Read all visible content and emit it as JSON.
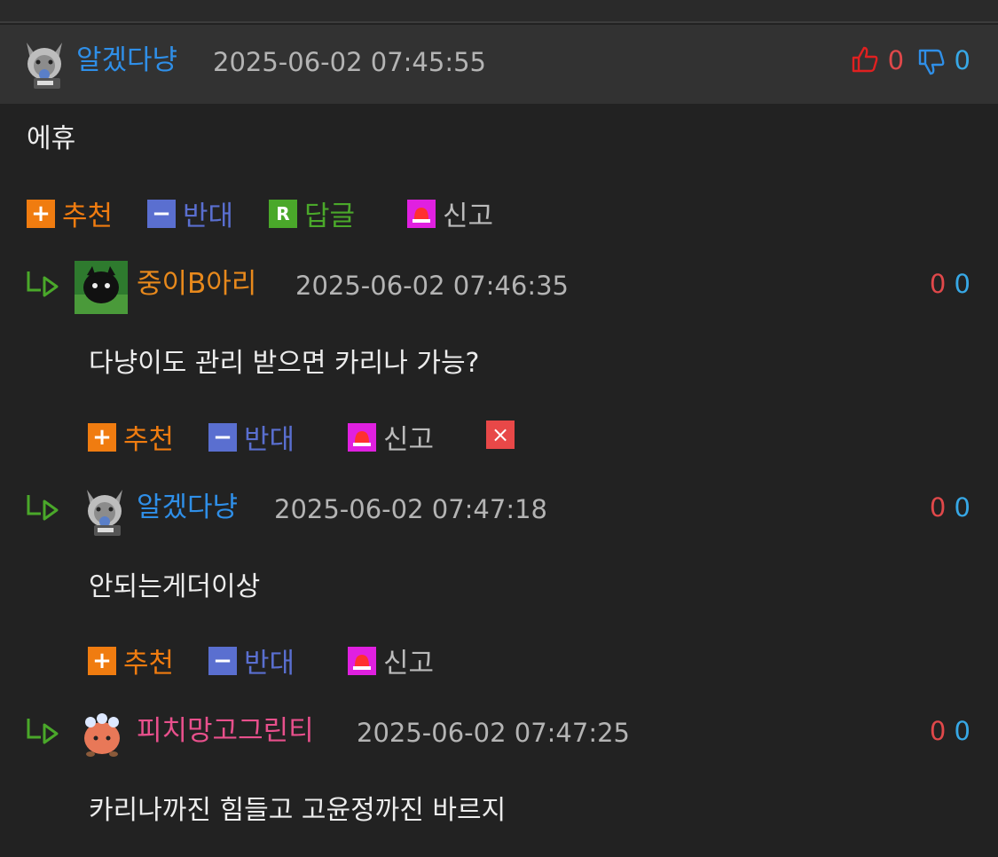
{
  "comments": [
    {
      "author": "알겠다냥",
      "datetime": "2025-06-02 07:45:55",
      "upvotes": "0",
      "downvotes": "0",
      "text": "에휴",
      "actions": {
        "recommend": "추천",
        "oppose": "반대",
        "reply": "답글",
        "report": "신고"
      }
    },
    {
      "author": "중이B아리",
      "datetime": "2025-06-02 07:46:35",
      "upvotes": "0",
      "downvotes": "0",
      "text": "다냥이도 관리 받으면 카리나 가능?",
      "actions": {
        "recommend": "추천",
        "oppose": "반대",
        "report": "신고"
      }
    },
    {
      "author": "알겠다냥",
      "datetime": "2025-06-02 07:47:18",
      "upvotes": "0",
      "downvotes": "0",
      "text": "안되는게더이상",
      "actions": {
        "recommend": "추천",
        "oppose": "반대",
        "report": "신고"
      }
    },
    {
      "author": "피치망고그린티",
      "datetime": "2025-06-02 07:47:25",
      "upvotes": "0",
      "downvotes": "0",
      "text": "카리나까진 힘들고 고윤정까진 바르지"
    }
  ],
  "icons": {
    "recommend": "plus-icon",
    "oppose": "minus-icon",
    "reply": "reply-r-icon",
    "report": "siren-icon",
    "delete": "close-icon",
    "thumbs_up": "thumbs-up-icon",
    "thumbs_down": "thumbs-down-icon",
    "reply_indicator": "reply-arrow-icon"
  },
  "colors": {
    "background": "#222222",
    "header": "#323232",
    "author_blue": "#2f8fe8",
    "author_orange": "#e8891c",
    "author_pink": "#e8508c",
    "recommend": "#f07c10",
    "oppose": "#5a6fd0",
    "reply": "#4aa82a",
    "report": "#e020e0",
    "delete": "#e84848",
    "vote_up": "#e0484a",
    "vote_down": "#37a8e6"
  }
}
